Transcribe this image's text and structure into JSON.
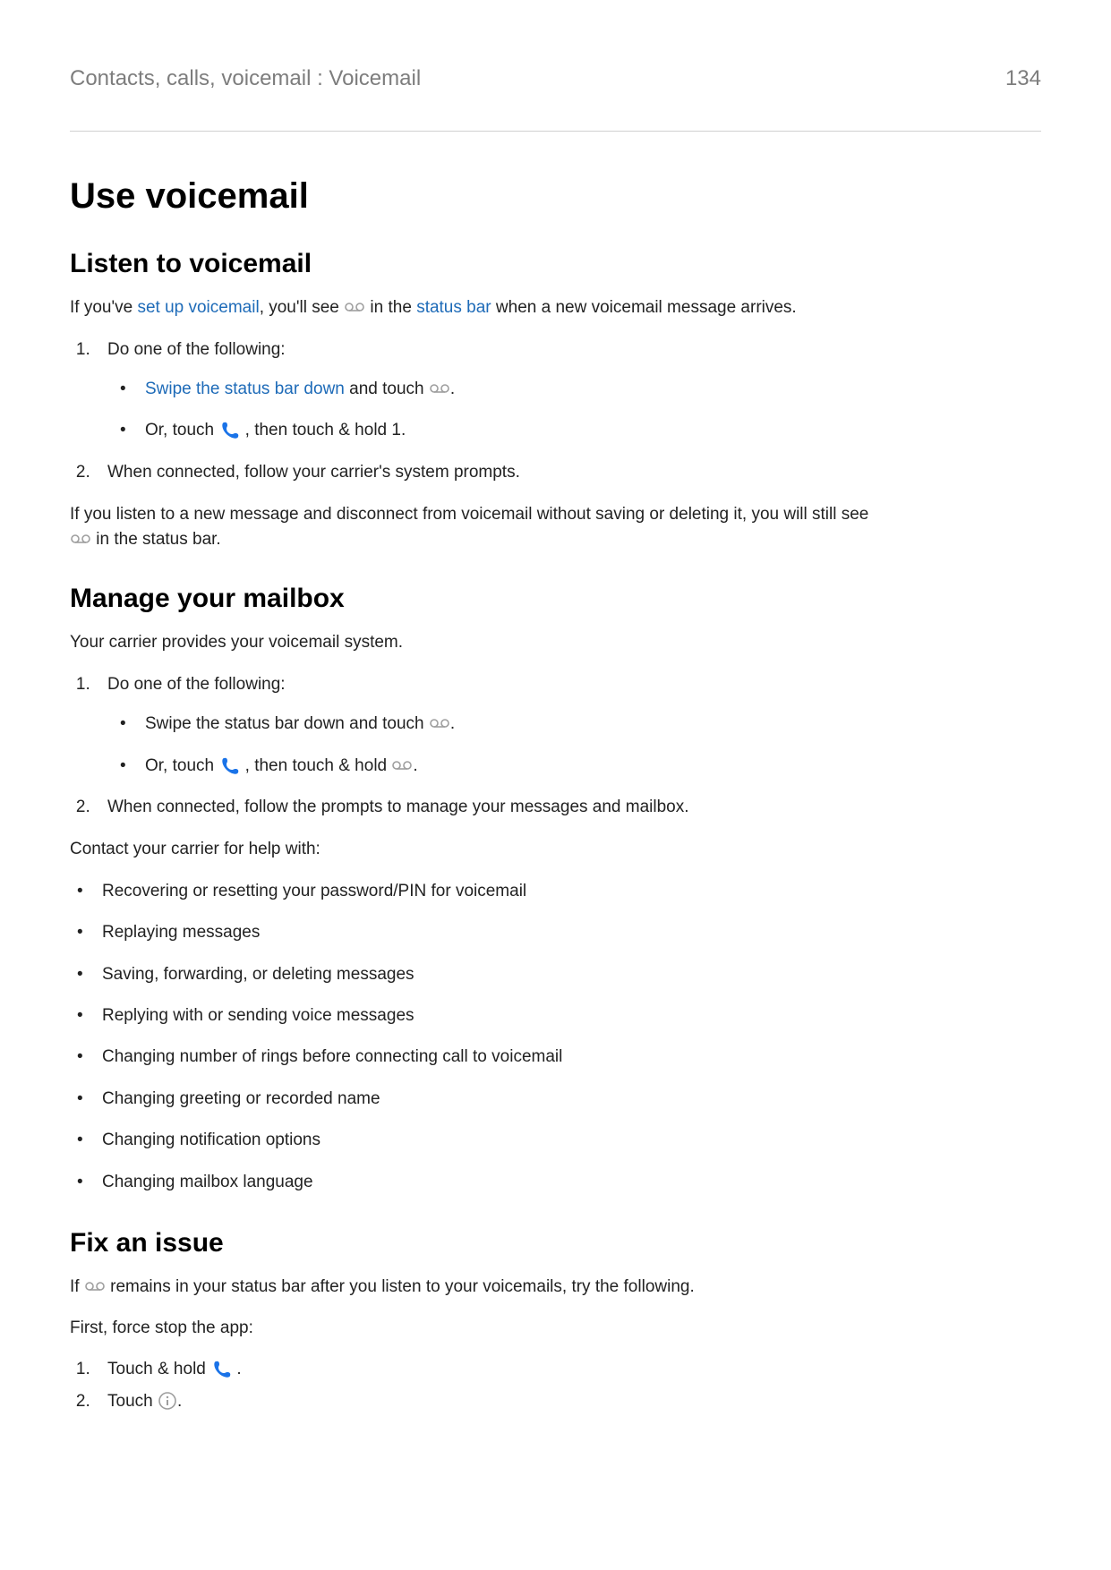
{
  "breadcrumb": "Contacts, calls, voicemail : Voicemail",
  "pageNumber": "134",
  "h1": "Use voicemail",
  "listen": {
    "heading": "Listen to voicemail",
    "intro": {
      "p1": "If you've ",
      "link1": "set up voicemail",
      "p2": ", you'll see ",
      "p3": " in the ",
      "link2": "status bar",
      "p4": " when a new voicemail message arrives."
    },
    "step1": "Do one of the following:",
    "sub1": {
      "link": "Swipe the status bar down",
      "after": " and touch ",
      "end": "."
    },
    "sub2": {
      "before": "Or, touch ",
      "after": " , then touch & hold 1."
    },
    "step2": "When connected, follow your carrier's system prompts.",
    "outro": {
      "p1": "If you listen to a new message and disconnect from voicemail without saving or deleting it, you will still see ",
      "p2": " in the status bar."
    }
  },
  "manage": {
    "heading": "Manage your mailbox",
    "intro": "Your carrier provides your voicemail system.",
    "step1": "Do one of the following:",
    "sub1": {
      "before": "Swipe the status bar down and touch ",
      "end": "."
    },
    "sub2": {
      "before": "Or, touch ",
      "mid": " , then touch & hold ",
      "end": "."
    },
    "step2": "When connected, follow the prompts to manage your messages and mailbox.",
    "contact": "Contact your carrier for help with:",
    "bullets": [
      "Recovering or resetting your password/PIN for voicemail",
      "Replaying messages",
      "Saving, forwarding, or deleting messages",
      "Replying with or sending voice messages",
      "Changing number of rings before connecting call to voicemail",
      "Changing greeting or recorded name",
      "Changing notification options",
      "Changing mailbox language"
    ]
  },
  "fix": {
    "heading": "Fix an issue",
    "intro": {
      "p1": "If ",
      "p2": " remains in your status bar after you listen to your voicemails, try the following."
    },
    "force": "First, force stop the app:",
    "step1": {
      "before": "Touch & hold ",
      "after": " ."
    },
    "step2": {
      "before": "Touch ",
      "after": "."
    }
  }
}
